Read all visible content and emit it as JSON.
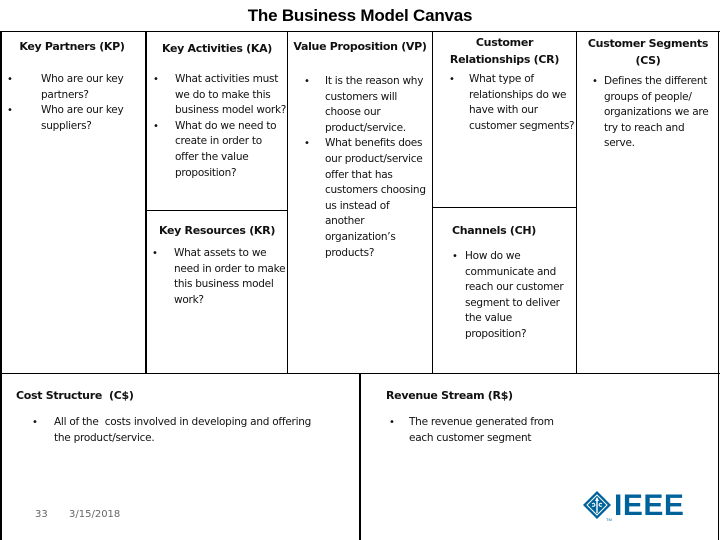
{
  "title": "The Business Model Canvas",
  "colors": {
    "border": "#000000",
    "ieee_blue": "#00629b",
    "footer_text": "#666666"
  },
  "sections": {
    "key_partners": {
      "heading": "Key Partners (KP)",
      "bullets": [
        "Who are our key partners?",
        "Who are our key suppliers?"
      ]
    },
    "key_activities": {
      "heading": "Key Activities (KA)",
      "bullets": [
        "What activities must we do to make this business model work?",
        "What do we need to create in order to offer the value proposition?"
      ]
    },
    "key_resources": {
      "heading": "Key Resources (KR)",
      "bullets": [
        "What assets to we need in order to make this business model work?"
      ]
    },
    "value_proposition": {
      "heading": "Value Proposition (VP)",
      "bullets": [
        "It is the reason why customers will choose our product/service.",
        "What benefits does our product/service offer that has customers choosing us instead of another organization’s products?"
      ]
    },
    "customer_relationships": {
      "heading_line1": "Customer",
      "heading_line2": "Relationships (CR)",
      "bullets": [
        "What type of relationships do we have with our customer segments?"
      ]
    },
    "channels": {
      "heading": "Channels (CH)",
      "bullets": [
        "How do we communicate and reach our customer segment to deliver the value proposition?"
      ]
    },
    "customer_segments": {
      "heading_line1": "Customer Segments",
      "heading_line2": "(CS)",
      "bullets": [
        "Defines the different groups of people/ organizations we are try to reach and serve."
      ]
    },
    "cost_structure": {
      "heading": "Cost Structure  (C$)",
      "bullets": [
        "All of the  costs involved in developing and offering the product/service."
      ]
    },
    "revenue_stream": {
      "heading": "Revenue Stream (R$)",
      "bullets": [
        "The revenue generated from each customer segment"
      ]
    }
  },
  "footer": {
    "slide_number": "33",
    "date": "3/15/2018"
  },
  "logo": {
    "icon": "ieee-diamond-icon",
    "text": "IEEE"
  },
  "bullet_glyph": "•"
}
